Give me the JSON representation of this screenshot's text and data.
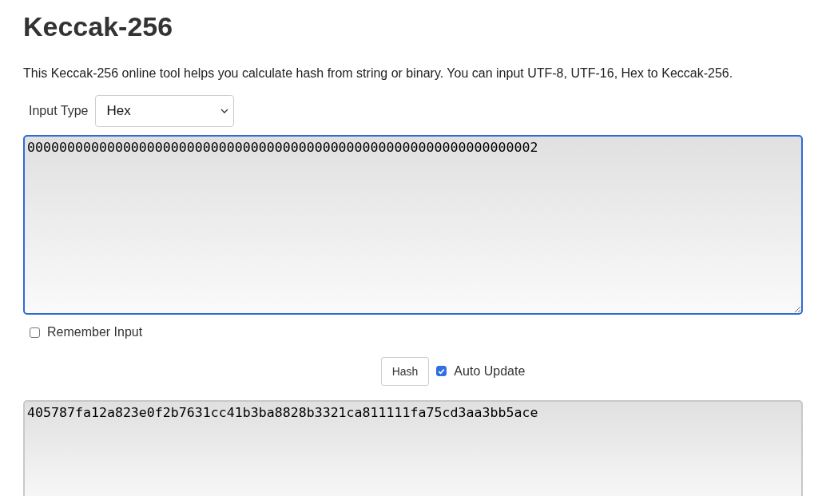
{
  "title": "Keccak-256",
  "description": "This Keccak-256 online tool helps you calculate hash from string or binary. You can input UTF-8, UTF-16, Hex to Keccak-256.",
  "input_type": {
    "label": "Input Type",
    "value": "Hex"
  },
  "input": {
    "value": "0000000000000000000000000000000000000000000000000000000000000002",
    "focused": true
  },
  "remember_input": {
    "label": "Remember Input",
    "checked": false
  },
  "hash_button": "Hash",
  "auto_update": {
    "label": "Auto Update",
    "checked": true
  },
  "output": {
    "value": "405787fa12a823e0f2b7631cc41b3ba8828b3321ca811111fa75cd3aa3bb5ace",
    "focused": false
  }
}
